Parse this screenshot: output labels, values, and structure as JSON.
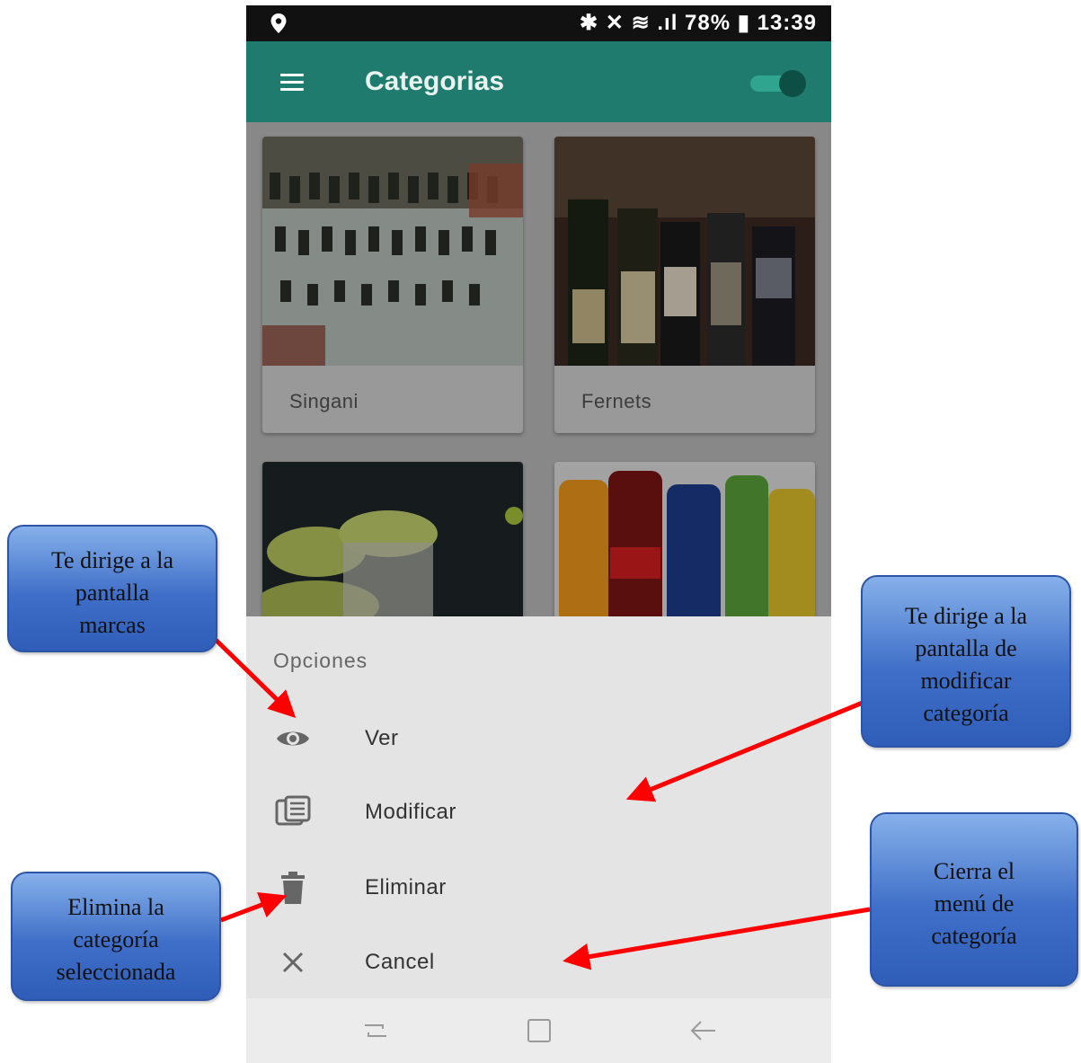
{
  "status_bar": {
    "right_text": "✱ ✕ ≋ .ıl 78% ▮ 13:39"
  },
  "appbar": {
    "title": "Categorias"
  },
  "categories": [
    {
      "label": "Singani"
    },
    {
      "label": "Fernets"
    }
  ],
  "sheet": {
    "heading": "Opciones",
    "options": [
      {
        "label": "Ver",
        "icon": "eye-icon"
      },
      {
        "label": "Modificar",
        "icon": "edit-icon"
      },
      {
        "label": "Eliminar",
        "icon": "trash-icon"
      },
      {
        "label": "Cancel",
        "icon": "close-icon"
      }
    ]
  },
  "navbar": {
    "icons": [
      "recents-icon",
      "home-icon",
      "back-icon"
    ]
  },
  "callouts": {
    "ver": [
      "Te dirige a la",
      "pantalla",
      "marcas"
    ],
    "modificar": [
      "Te dirige a la",
      "pantalla de",
      "modificar",
      "categoría"
    ],
    "eliminar": [
      "Elimina la",
      "categoría",
      "seleccionada"
    ],
    "cancel": [
      "Cierra el",
      "menú de",
      "categoría"
    ]
  },
  "colors": {
    "appbar": "#1f7b6d",
    "sheet": "#e4e4e4",
    "arrow": "#ff0000",
    "callout": "#4472c4"
  }
}
